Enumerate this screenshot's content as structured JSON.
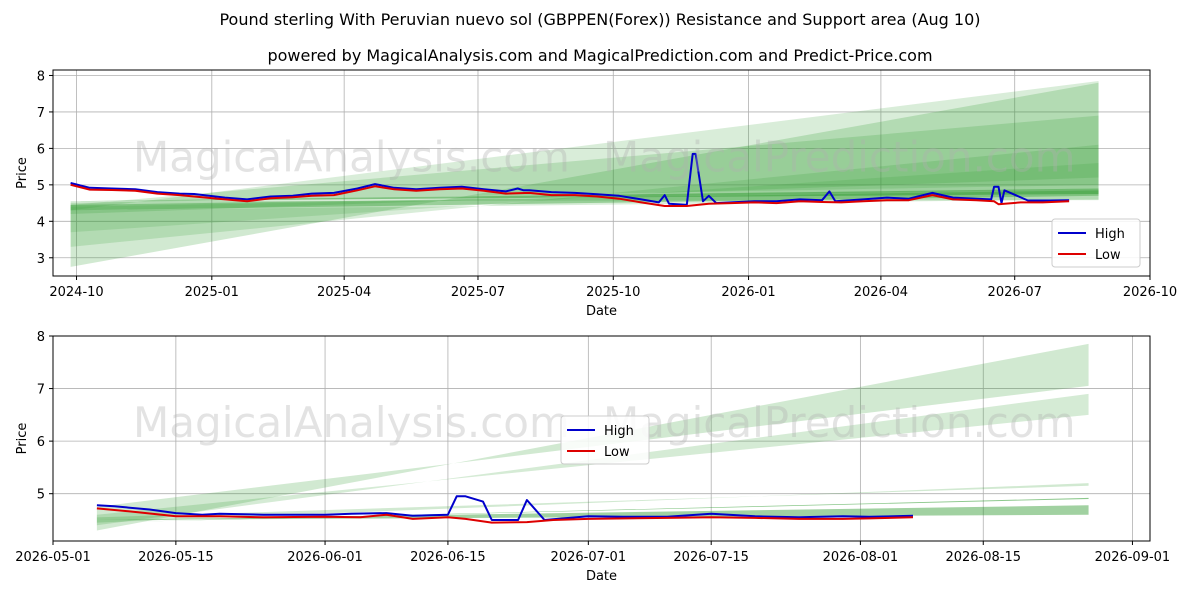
{
  "title": "Pound sterling With Peruvian nuevo sol (GBPPEN(Forex)) Resistance and Support area (Aug 10)",
  "subtitle": "powered by MagicalAnalysis.com and MagicalPrediction.com and Predict-Price.com",
  "watermarks": [
    "MagicalAnalysis.com",
    "MagicalPrediction.com"
  ],
  "colors": {
    "high": "#0000cc",
    "low": "#dd0000",
    "band": "#2e9a2e"
  },
  "chart_data": [
    {
      "type": "line",
      "xlabel": "Date",
      "ylabel": "Price",
      "xlim": [
        "2024-09-15",
        "2026-10-01"
      ],
      "ylim": [
        2.5,
        8.15
      ],
      "xticks": [
        "2024-10",
        "2025-01",
        "2025-04",
        "2025-07",
        "2025-10",
        "2026-01",
        "2026-04",
        "2026-07",
        "2026-10"
      ],
      "yticks": [
        3,
        4,
        5,
        6,
        7,
        8
      ],
      "legend": "lower-right",
      "grid": true,
      "bands": [
        {
          "x0": "2024-09-27",
          "x1": "2026-08-27",
          "y0a": 2.75,
          "y1a": 7.8,
          "y0b": 4.55,
          "y1b": 4.58,
          "opacity": 0.22
        },
        {
          "x0": "2024-09-27",
          "x1": "2026-08-27",
          "y0a": 3.3,
          "y1a": 6.1,
          "y0b": 4.3,
          "y1b": 4.6,
          "opacity": 0.18
        },
        {
          "x0": "2024-09-27",
          "x1": "2026-08-27",
          "y0a": 3.7,
          "y1a": 5.6,
          "y0b": 4.4,
          "y1b": 4.9,
          "opacity": 0.16
        },
        {
          "x0": "2024-09-27",
          "x1": "2026-08-27",
          "y0a": 4.2,
          "y1a": 5.2,
          "y0b": 4.45,
          "y1b": 6.9,
          "opacity": 0.2
        },
        {
          "x0": "2024-09-27",
          "x1": "2026-08-27",
          "y0a": 4.5,
          "y1a": 5.0,
          "y0b": 4.3,
          "y1b": 7.85,
          "opacity": 0.18
        },
        {
          "x0": "2024-09-27",
          "x1": "2026-08-27",
          "y0a": 4.3,
          "y1a": 4.7,
          "y0b": 4.45,
          "y1b": 4.85,
          "opacity": 0.38
        },
        {
          "x0": "2024-09-27",
          "x1": "2026-08-27",
          "y0a": 4.55,
          "y1a": 4.9,
          "y0b": 4.55,
          "y1b": 4.75,
          "opacity": 0.5
        }
      ],
      "series": [
        {
          "name": "High",
          "x": [
            "2024-09-27",
            "2024-10-10",
            "2024-10-25",
            "2024-11-10",
            "2024-11-25",
            "2024-12-10",
            "2024-12-20",
            "2025-01-10",
            "2025-01-25",
            "2025-02-10",
            "2025-02-25",
            "2025-03-10",
            "2025-03-25",
            "2025-04-10",
            "2025-04-22",
            "2025-05-05",
            "2025-05-20",
            "2025-06-05",
            "2025-06-20",
            "2025-07-05",
            "2025-07-20",
            "2025-07-28",
            "2025-08-01",
            "2025-08-05",
            "2025-08-20",
            "2025-09-05",
            "2025-09-20",
            "2025-10-05",
            "2025-10-20",
            "2025-11-01",
            "2025-11-05",
            "2025-11-08",
            "2025-11-20",
            "2025-11-24",
            "2025-11-26",
            "2025-12-01",
            "2025-12-05",
            "2025-12-10",
            "2025-12-20",
            "2026-01-05",
            "2026-01-20",
            "2026-02-05",
            "2026-02-20",
            "2026-02-25",
            "2026-03-01",
            "2026-03-20",
            "2026-04-05",
            "2026-04-20",
            "2026-05-06",
            "2026-05-20",
            "2026-06-05",
            "2026-06-15",
            "2026-06-17",
            "2026-06-20",
            "2026-06-22",
            "2026-06-24",
            "2026-07-10",
            "2026-07-25",
            "2026-08-07"
          ],
          "y": [
            5.05,
            4.92,
            4.9,
            4.88,
            4.8,
            4.76,
            4.75,
            4.65,
            4.6,
            4.68,
            4.7,
            4.76,
            4.78,
            4.9,
            5.02,
            4.92,
            4.88,
            4.92,
            4.95,
            4.88,
            4.82,
            4.9,
            4.85,
            4.85,
            4.8,
            4.78,
            4.74,
            4.7,
            4.6,
            4.52,
            4.72,
            4.48,
            4.45,
            5.85,
            5.85,
            4.55,
            4.7,
            4.5,
            4.52,
            4.55,
            4.55,
            4.6,
            4.58,
            4.82,
            4.55,
            4.6,
            4.65,
            4.62,
            4.78,
            4.65,
            4.62,
            4.6,
            4.95,
            4.95,
            4.5,
            4.85,
            4.57,
            4.57,
            4.58
          ]
        },
        {
          "name": "Low",
          "x": [
            "2024-09-27",
            "2024-10-10",
            "2024-10-25",
            "2024-11-10",
            "2024-11-25",
            "2024-12-10",
            "2024-12-20",
            "2025-01-10",
            "2025-01-25",
            "2025-02-10",
            "2025-02-25",
            "2025-03-10",
            "2025-03-25",
            "2025-04-10",
            "2025-04-22",
            "2025-05-05",
            "2025-05-20",
            "2025-06-05",
            "2025-06-20",
            "2025-07-05",
            "2025-07-20",
            "2025-08-05",
            "2025-08-20",
            "2025-09-05",
            "2025-09-20",
            "2025-10-05",
            "2025-10-20",
            "2025-11-05",
            "2025-11-20",
            "2025-12-05",
            "2025-12-20",
            "2026-01-05",
            "2026-01-20",
            "2026-02-05",
            "2026-02-20",
            "2026-03-05",
            "2026-03-20",
            "2026-04-05",
            "2026-04-20",
            "2026-05-06",
            "2026-05-20",
            "2026-06-05",
            "2026-06-17",
            "2026-06-20",
            "2026-07-05",
            "2026-07-20",
            "2026-08-07"
          ],
          "y": [
            5.0,
            4.87,
            4.86,
            4.84,
            4.76,
            4.72,
            4.68,
            4.6,
            4.55,
            4.63,
            4.66,
            4.7,
            4.72,
            4.85,
            4.96,
            4.88,
            4.84,
            4.88,
            4.9,
            4.84,
            4.76,
            4.78,
            4.72,
            4.72,
            4.68,
            4.62,
            4.52,
            4.42,
            4.42,
            4.48,
            4.5,
            4.52,
            4.5,
            4.55,
            4.53,
            4.52,
            4.55,
            4.58,
            4.58,
            4.72,
            4.6,
            4.58,
            4.55,
            4.47,
            4.52,
            4.52,
            4.55
          ]
        }
      ]
    },
    {
      "type": "line",
      "xlabel": "Date",
      "ylabel": "Price",
      "xlim": [
        "2026-05-01",
        "2026-09-03"
      ],
      "ylim": [
        4.1,
        8.0
      ],
      "xticks": [
        "2026-05-01",
        "2026-05-15",
        "2026-06-01",
        "2026-06-15",
        "2026-07-01",
        "2026-07-15",
        "2026-08-01",
        "2026-08-15",
        "2026-09-01"
      ],
      "yticks": [
        5,
        6,
        7,
        8
      ],
      "legend": "center",
      "grid": true,
      "bands": [
        {
          "x0": "2026-05-06",
          "x1": "2026-08-27",
          "y0a": 4.75,
          "y1a": 7.05,
          "y0b": 4.3,
          "y1b": 7.85,
          "opacity": 0.22
        },
        {
          "x0": "2026-05-06",
          "x1": "2026-08-27",
          "y0a": 4.6,
          "y1a": 6.5,
          "y0b": 4.4,
          "y1b": 6.9,
          "opacity": 0.2
        },
        {
          "x0": "2026-05-06",
          "x1": "2026-08-27",
          "y0a": 4.55,
          "y1a": 5.15,
          "y0b": 4.45,
          "y1b": 5.2,
          "opacity": 0.22
        },
        {
          "x0": "2026-05-06",
          "x1": "2026-08-27",
          "y0a": 4.45,
          "y1a": 4.92,
          "y0b": 4.45,
          "y1b": 4.9,
          "opacity": 0.55
        },
        {
          "x0": "2026-05-06",
          "x1": "2026-08-27",
          "y0a": 4.5,
          "y1a": 4.78,
          "y0b": 4.5,
          "y1b": 4.6,
          "opacity": 0.45
        }
      ],
      "series": [
        {
          "name": "High",
          "x": [
            "2026-05-06",
            "2026-05-08",
            "2026-05-12",
            "2026-05-15",
            "2026-05-18",
            "2026-05-20",
            "2026-05-25",
            "2026-06-01",
            "2026-06-04",
            "2026-06-08",
            "2026-06-11",
            "2026-06-15",
            "2026-06-16",
            "2026-06-17",
            "2026-06-18",
            "2026-06-19",
            "2026-06-20",
            "2026-06-22",
            "2026-06-23",
            "2026-06-24",
            "2026-06-26",
            "2026-07-01",
            "2026-07-05",
            "2026-07-10",
            "2026-07-15",
            "2026-07-20",
            "2026-07-25",
            "2026-07-30",
            "2026-08-02",
            "2026-08-07"
          ],
          "y": [
            4.78,
            4.76,
            4.7,
            4.63,
            4.6,
            4.62,
            4.6,
            4.6,
            4.62,
            4.63,
            4.58,
            4.6,
            4.95,
            4.95,
            4.9,
            4.85,
            4.5,
            4.5,
            4.5,
            4.88,
            4.5,
            4.57,
            4.56,
            4.56,
            4.62,
            4.57,
            4.55,
            4.57,
            4.56,
            4.58
          ]
        },
        {
          "name": "Low",
          "x": [
            "2026-05-06",
            "2026-05-10",
            "2026-05-15",
            "2026-05-20",
            "2026-05-25",
            "2026-06-01",
            "2026-06-05",
            "2026-06-08",
            "2026-06-11",
            "2026-06-15",
            "2026-06-17",
            "2026-06-20",
            "2026-06-24",
            "2026-06-27",
            "2026-07-01",
            "2026-07-10",
            "2026-07-15",
            "2026-07-20",
            "2026-07-25",
            "2026-07-30",
            "2026-08-02",
            "2026-08-07"
          ],
          "y": [
            4.72,
            4.66,
            4.57,
            4.57,
            4.55,
            4.56,
            4.55,
            4.6,
            4.52,
            4.55,
            4.52,
            4.45,
            4.46,
            4.5,
            4.52,
            4.54,
            4.55,
            4.54,
            4.52,
            4.52,
            4.53,
            4.55
          ]
        }
      ]
    }
  ]
}
